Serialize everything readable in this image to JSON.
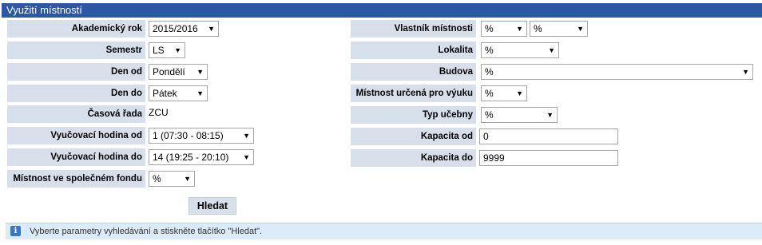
{
  "title": "Využití místností",
  "left": {
    "academic_year": {
      "label": "Akademický rok",
      "value": "2015/2016"
    },
    "semester": {
      "label": "Semestr",
      "value": "LS"
    },
    "day_from": {
      "label": "Den od",
      "value": "Pondělí"
    },
    "day_to": {
      "label": "Den do",
      "value": "Pátek"
    },
    "time_series": {
      "label": "Časová řada",
      "value": "ZCU"
    },
    "hour_from": {
      "label": "Vyučovací hodina od",
      "value": "1 (07:30 - 08:15)"
    },
    "hour_to": {
      "label": "Vyučovací hodina do",
      "value": "14 (19:25 - 20:10)"
    },
    "common_fund": {
      "label": "Místnost ve společném fondu",
      "value": "%"
    }
  },
  "right": {
    "owner": {
      "label": "Vlastník místnosti",
      "value1": "%",
      "value2": "%"
    },
    "locality": {
      "label": "Lokalita",
      "value": "%"
    },
    "building": {
      "label": "Budova",
      "value": "%"
    },
    "teaching_room": {
      "label": "Místnost určená pro výuku",
      "value": "%"
    },
    "classroom_type": {
      "label": "Typ učebny",
      "value": "%"
    },
    "capacity_from": {
      "label": "Kapacita od",
      "value": "0"
    },
    "capacity_to": {
      "label": "Kapacita do",
      "value": "9999"
    }
  },
  "search_button": "Hledat",
  "info": {
    "icon": "info-icon",
    "text": "Vyberte parametry vyhledávání a stiskněte tlačítko \"Hledat\"."
  },
  "colors": {
    "titlebar": "#2b57a4",
    "label_bg": "#d7e0ea",
    "info_bg": "#dcebf8"
  }
}
